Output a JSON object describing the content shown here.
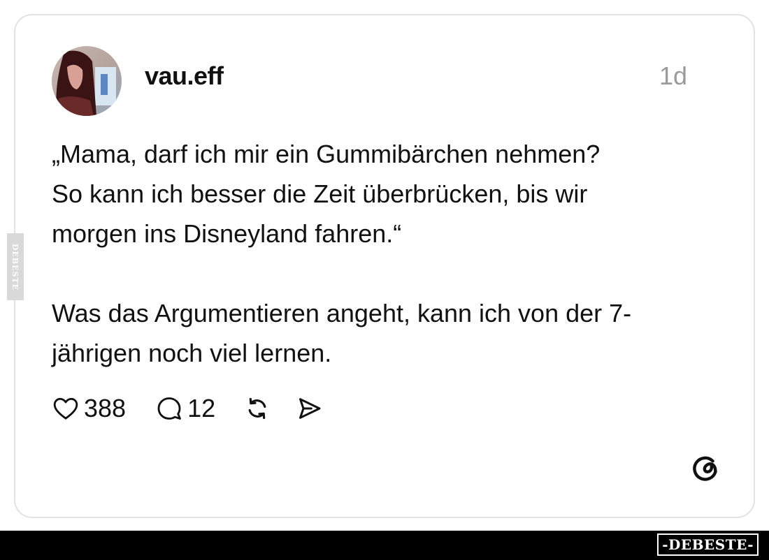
{
  "post": {
    "username": "vau.eff",
    "timestamp": "1d",
    "paragraphs": [
      "„Mama, darf ich mir ein Gummibärchen nehmen?",
      "So kann ich besser die Zeit überbrücken, bis wir",
      "morgen ins Disneyland fahren.“",
      "Was das Argumentieren angeht, kann ich von der 7-",
      "jährigen noch viel lernen."
    ],
    "likes": "388",
    "replies": "12"
  },
  "icons": {
    "like": "heart-icon",
    "reply": "speech-bubble-icon",
    "repost": "repost-icon",
    "share": "send-icon",
    "brand": "threads-logo-icon"
  },
  "watermark": {
    "side": "DEBESTE",
    "footer": "-DEBESTE-"
  },
  "colors": {
    "text": "#111111",
    "muted": "#9a9a9a",
    "card_border": "#e2e2e2",
    "footer": "#000000"
  }
}
